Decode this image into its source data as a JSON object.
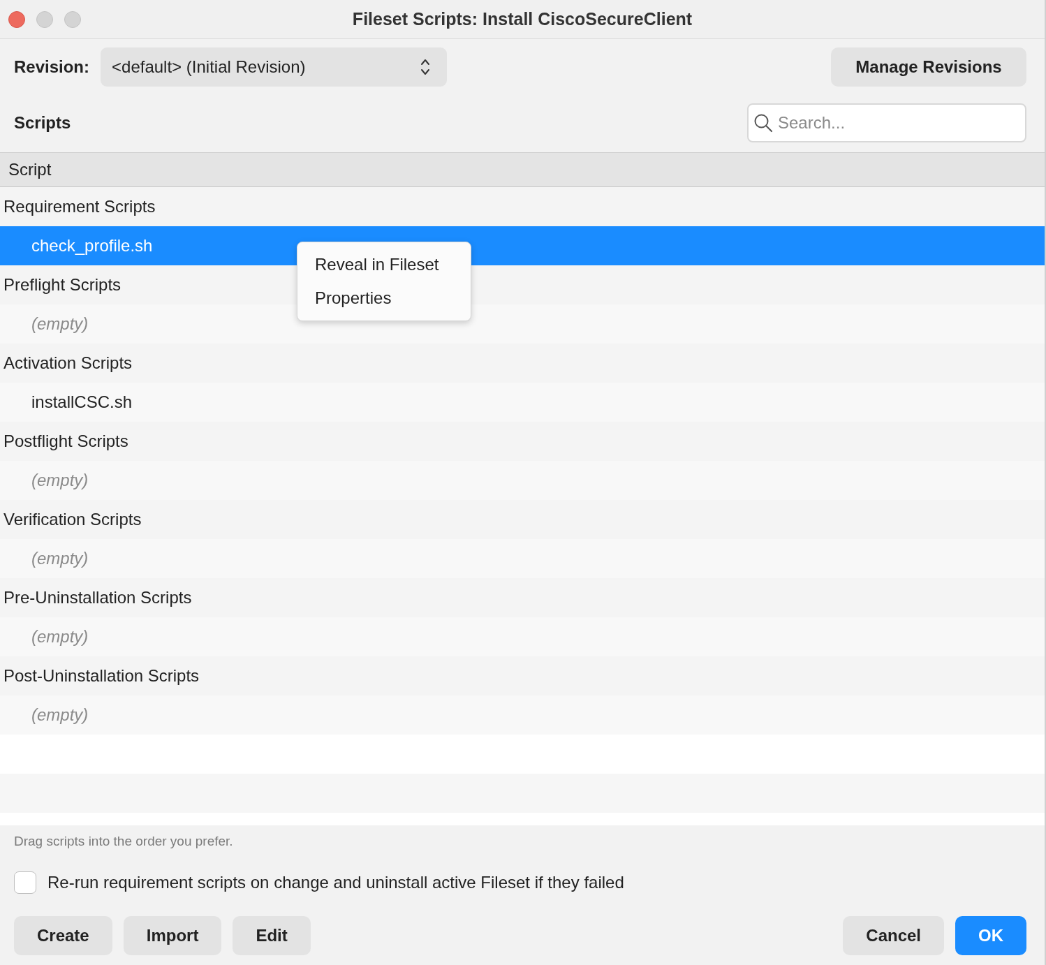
{
  "window": {
    "title": "Fileset Scripts: Install CiscoSecureClient"
  },
  "revision": {
    "label": "Revision:",
    "value": "<default> (Initial Revision)"
  },
  "manage_button": "Manage Revisions",
  "scripts_heading": "Scripts",
  "search": {
    "placeholder": "Search..."
  },
  "table": {
    "columns": [
      "Script"
    ],
    "groups": [
      {
        "label": "Requirement Scripts",
        "selected": false,
        "children": [
          {
            "label": "check_profile.sh",
            "kind": "script",
            "selected": true
          }
        ]
      },
      {
        "label": "Preflight Scripts",
        "selected": false,
        "children": [
          {
            "label": "(empty)",
            "kind": "placeholder",
            "selected": false
          }
        ]
      },
      {
        "label": "Activation Scripts",
        "selected": false,
        "children": [
          {
            "label": "installCSC.sh",
            "kind": "script",
            "selected": false
          }
        ]
      },
      {
        "label": "Postflight Scripts",
        "selected": false,
        "children": [
          {
            "label": "(empty)",
            "kind": "placeholder",
            "selected": false
          }
        ]
      },
      {
        "label": "Verification Scripts",
        "selected": false,
        "children": [
          {
            "label": "(empty)",
            "kind": "placeholder",
            "selected": false
          }
        ]
      },
      {
        "label": "Pre-Uninstallation Scripts",
        "selected": false,
        "children": [
          {
            "label": "(empty)",
            "kind": "placeholder",
            "selected": false
          }
        ]
      },
      {
        "label": "Post-Uninstallation Scripts",
        "selected": false,
        "children": [
          {
            "label": "(empty)",
            "kind": "placeholder",
            "selected": false
          }
        ]
      }
    ]
  },
  "context_menu": {
    "items": [
      {
        "label": "Reveal in Fileset"
      },
      {
        "label": "Properties"
      }
    ]
  },
  "hint": "Drag scripts into the order you prefer.",
  "checkbox": {
    "label": "Re-run requirement scripts on change and uninstall active Fileset if they failed",
    "checked": false
  },
  "buttons_left": [
    {
      "label": "Create"
    },
    {
      "label": "Import"
    },
    {
      "label": "Edit"
    }
  ],
  "buttons_right": [
    {
      "label": "Cancel",
      "kind": "normal"
    },
    {
      "label": "OK",
      "kind": "default"
    }
  ]
}
